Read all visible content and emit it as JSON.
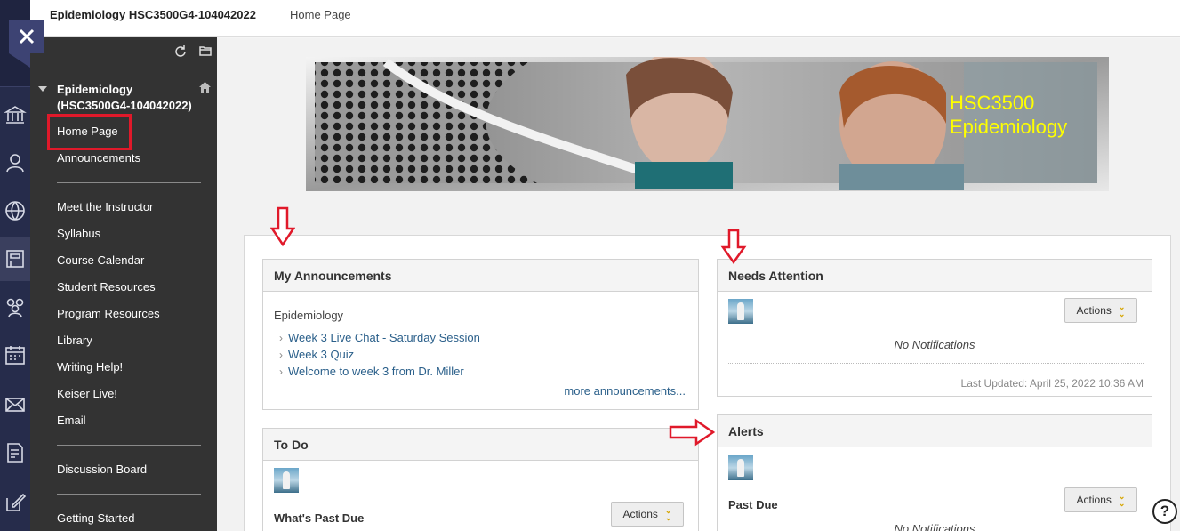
{
  "topbar": {
    "course_title": "Epidemiology HSC3500G4-104042022",
    "breadcrumb": "Home Page"
  },
  "course_menu": {
    "title": "Epidemiology (HSC3500G4-104042022)",
    "items": [
      {
        "label": "Home Page"
      },
      {
        "label": "Announcements"
      },
      {
        "label": "Meet the Instructor"
      },
      {
        "label": "Syllabus"
      },
      {
        "label": "Course Calendar"
      },
      {
        "label": "Student Resources"
      },
      {
        "label": "Program Resources"
      },
      {
        "label": "Library"
      },
      {
        "label": "Writing Help!"
      },
      {
        "label": "Keiser Live!"
      },
      {
        "label": "Email"
      },
      {
        "label": "Discussion Board"
      },
      {
        "label": "Getting Started"
      }
    ]
  },
  "banner": {
    "line1": "HSC3500",
    "line2": "Epidemiology"
  },
  "my_announcements": {
    "title": "My Announcements",
    "course": "Epidemiology",
    "links": [
      "Week 3 Live Chat - Saturday Session",
      "Week 3 Quiz",
      "Welcome to week 3 from Dr. Miller"
    ],
    "more": "more announcements..."
  },
  "needs_attention": {
    "title": "Needs Attention",
    "actions_label": "Actions",
    "no_notifications": "No Notifications",
    "last_updated": "Last Updated: April 25, 2022 10:36 AM"
  },
  "to_do": {
    "title": "To Do",
    "actions_label": "Actions",
    "past_due": "What's Past Due"
  },
  "alerts": {
    "title": "Alerts",
    "actions_label": "Actions",
    "past_due": "Past Due",
    "no_notifications": "No Notifications"
  },
  "colors": {
    "rail": "#262c4b",
    "menu": "#333333",
    "highlight": "#e0192a",
    "link": "#2a5f8a",
    "banner_text": "#ffff00"
  },
  "help": {
    "glyph": "?"
  }
}
